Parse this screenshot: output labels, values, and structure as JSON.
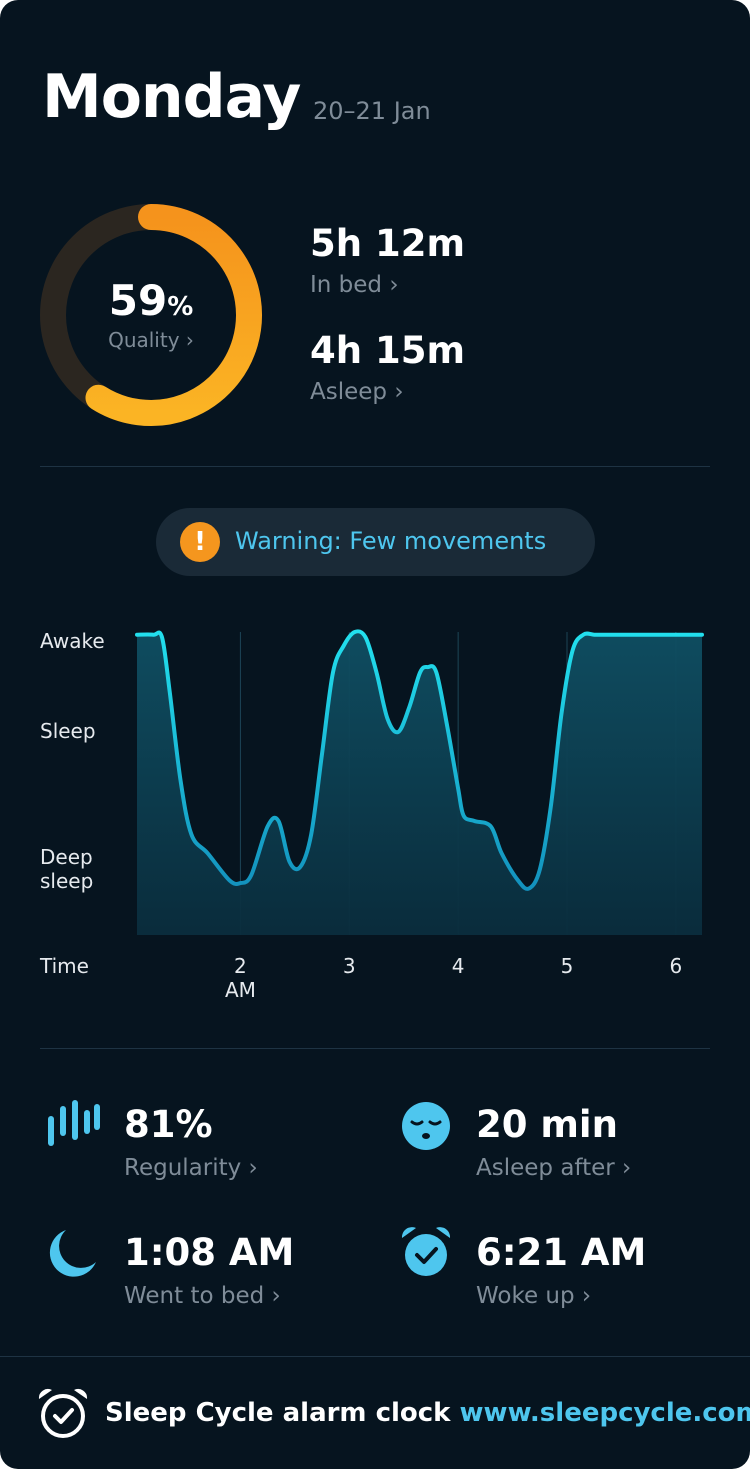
{
  "header": {
    "day": "Monday",
    "date": "20–21 Jan"
  },
  "quality": {
    "value": "59",
    "unit": "%",
    "label": "Quality ›",
    "fraction": 0.59
  },
  "stats": {
    "in_bed": {
      "value": "5h 12m",
      "label": "In bed ›"
    },
    "asleep": {
      "value": "4h 15m",
      "label": "Asleep ›"
    }
  },
  "warning": {
    "icon": "exclamation-icon",
    "text": "Warning: Few movements"
  },
  "chart_data": {
    "type": "area",
    "y_levels": [
      "Awake",
      "Sleep",
      "Deep sleep"
    ],
    "y_labels": {
      "awake": "Awake",
      "sleep": "Sleep",
      "deep_line1": "Deep",
      "deep_line2": "sleep"
    },
    "x_title": "Time",
    "x_ticks": [
      "2",
      "3",
      "4",
      "5",
      "6"
    ],
    "x_tick_sub": "AM",
    "x_range_hours": [
      1.05,
      6.24
    ],
    "series": [
      {
        "x": [
          1.05,
          1.2,
          1.28,
          1.35,
          1.45,
          1.55,
          1.7,
          1.9,
          2.0,
          2.1,
          2.25,
          2.35,
          2.45,
          2.55,
          2.65,
          2.75,
          2.85,
          2.95,
          3.05,
          3.15,
          3.25,
          3.35,
          3.45,
          3.55,
          3.65,
          3.72,
          3.8,
          3.9,
          4.0,
          4.05,
          4.15,
          4.3,
          4.4,
          4.55,
          4.65,
          4.75,
          4.85,
          4.95,
          5.05,
          5.15,
          5.25,
          5.35,
          5.45,
          5.55,
          5.65,
          5.72,
          5.8,
          6.0,
          6.24
        ],
        "y": [
          0.99,
          0.99,
          0.98,
          0.78,
          0.45,
          0.25,
          0.18,
          0.08,
          0.07,
          0.1,
          0.28,
          0.3,
          0.15,
          0.13,
          0.25,
          0.55,
          0.85,
          0.95,
          1.0,
          0.98,
          0.85,
          0.68,
          0.63,
          0.72,
          0.85,
          0.87,
          0.85,
          0.65,
          0.42,
          0.32,
          0.3,
          0.28,
          0.18,
          0.08,
          0.05,
          0.12,
          0.35,
          0.7,
          0.93,
          0.99,
          0.99,
          0.99,
          0.99,
          0.99,
          0.99,
          0.99,
          0.99,
          0.99,
          0.99
        ]
      }
    ],
    "line_color": "#1fd8e8",
    "grid": true
  },
  "bottom_stats": [
    {
      "icon": "regularity-bars-icon",
      "value": "81%",
      "label": "Regularity ›"
    },
    {
      "icon": "sleepy-face-icon",
      "value": "20 min",
      "label": "Asleep after ›"
    },
    {
      "icon": "moon-icon",
      "value": "1:08 AM",
      "label": "Went to bed ›"
    },
    {
      "icon": "alarm-clock-check-icon",
      "value": "6:21 AM",
      "label": "Woke up ›"
    }
  ],
  "footer": {
    "brand": "Sleep Cycle alarm clock",
    "link": "www.sleepcycle.com"
  },
  "colors": {
    "background": "#06141f",
    "accent": "#4ec6ee",
    "ring": "#f5a623",
    "warning": "#f5961e"
  }
}
